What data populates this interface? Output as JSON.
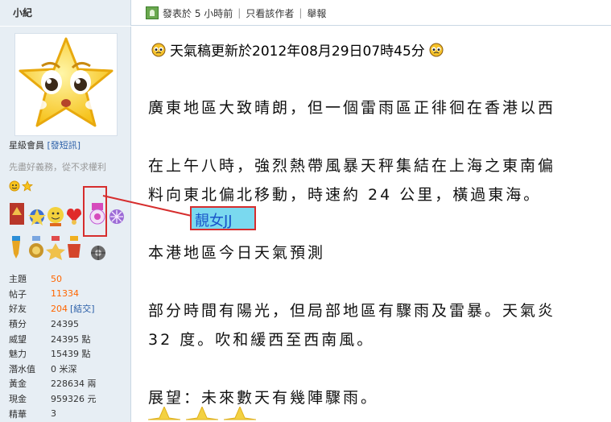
{
  "header": {
    "author_name": "小紀",
    "posted_label": "發表於 5 小時前",
    "view_author_label": "只看該作者",
    "report_label": "舉報"
  },
  "profile": {
    "rank_label": "星級會員",
    "rank_link": "[發短訊]",
    "signature": "先盡好義務，從不求權利",
    "stats": [
      {
        "label": "主題",
        "value": "50",
        "style": "accent"
      },
      {
        "label": "帖子",
        "value": "11334",
        "style": "accent"
      },
      {
        "label": "好友",
        "value": "204",
        "extra": "[結交]",
        "style": "accent"
      },
      {
        "label": "積分",
        "value": "24395",
        "style": "plain"
      },
      {
        "label": "威望",
        "value": "24395 點",
        "style": "plain"
      },
      {
        "label": "魅力",
        "value": "15439 點",
        "style": "plain"
      },
      {
        "label": "潛水值",
        "value": "0 米深",
        "style": "plain"
      },
      {
        "label": "黃金",
        "value": "228634 兩",
        "style": "plain"
      },
      {
        "label": "現金",
        "value": "959326 元",
        "style": "plain"
      },
      {
        "label": "精華",
        "value": "3",
        "style": "plain"
      }
    ]
  },
  "post": {
    "title": "天氣稿更新於2012年08月29日07時45分",
    "para1": "廣東地區大致晴朗，但一個雷雨區正徘徊在香港以西",
    "para2a": "在上午八時，強烈熱帶風暴天秤集結在上海之東南偏",
    "para2b": "料向東北偏北移動，時速約 24 公里，橫過東海。",
    "para3": "本港地區今日天氣預測",
    "para4a": "部分時間有陽光，但局部地區有驟雨及雷暴。天氣炎",
    "para4b": "32 度。吹和緩西至西南風。",
    "para5": "展望：未來數天有幾陣驟雨。"
  },
  "annotation": {
    "label": "靚女JJ",
    "color": "#d62d2d"
  },
  "colors": {
    "sidebar_bg": "#e7eef4",
    "accent_orange": "#ff6600",
    "link_blue": "#2b5fa8"
  }
}
